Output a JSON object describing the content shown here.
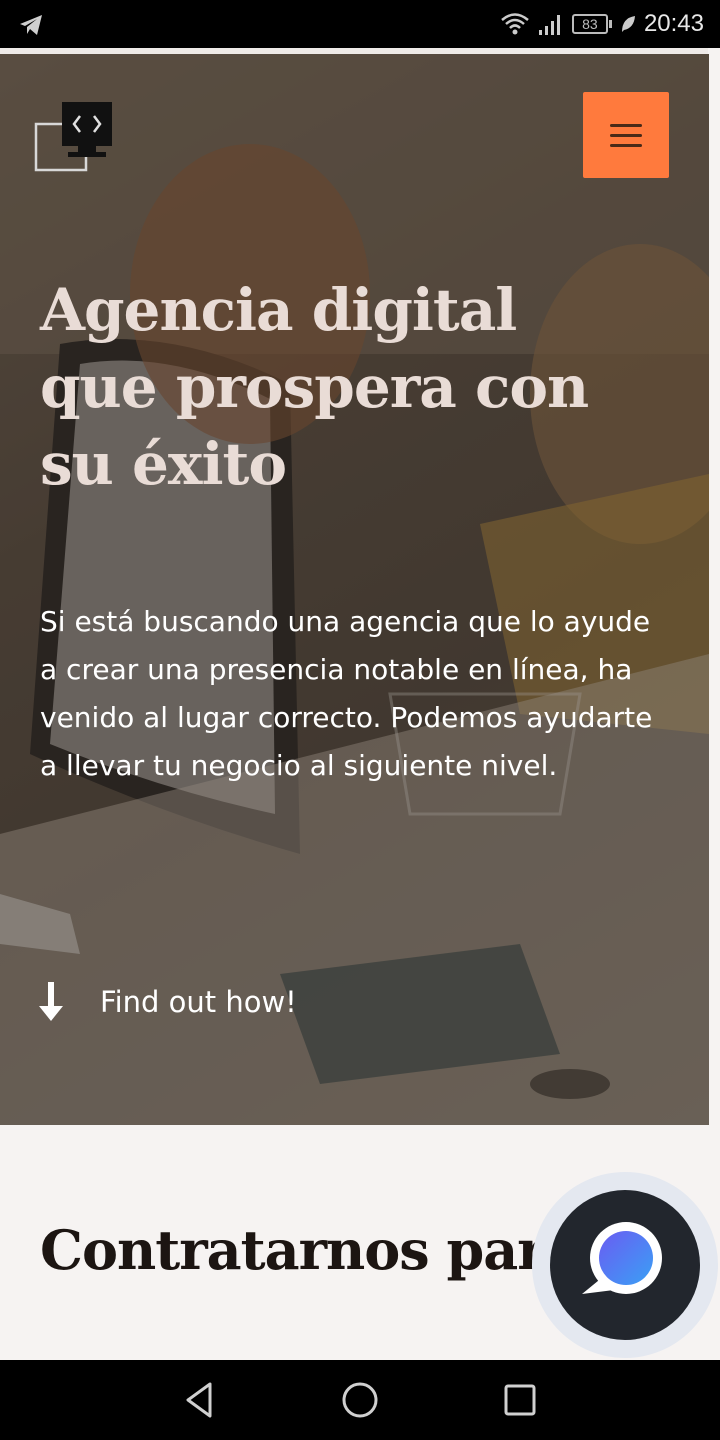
{
  "status_bar": {
    "time": "20:43",
    "battery_level": "83",
    "icons": [
      "telegram-icon",
      "wifi-icon",
      "signal-icon",
      "battery-icon",
      "leaf-icon"
    ]
  },
  "header": {
    "logo_icon": "code-monitor-logo-icon",
    "menu_icon": "hamburger-menu-icon",
    "accent_color": "#ff7a3d"
  },
  "hero": {
    "title": "Agencia digital que prospera con su éxito",
    "text": "Si está buscando una agencia que lo ayude a crear una presencia notable en línea, ha venido al lugar correcto. Podemos ayudarte a llevar tu negocio al siguiente nivel.",
    "cta_label": "Find out how!",
    "cta_icon": "arrow-down-icon"
  },
  "section": {
    "title": "Contratarnos para"
  },
  "chat": {
    "icon": "chat-bubble-icon"
  },
  "nav_bar": {
    "icons": [
      "back-icon",
      "home-icon",
      "recents-icon"
    ]
  }
}
